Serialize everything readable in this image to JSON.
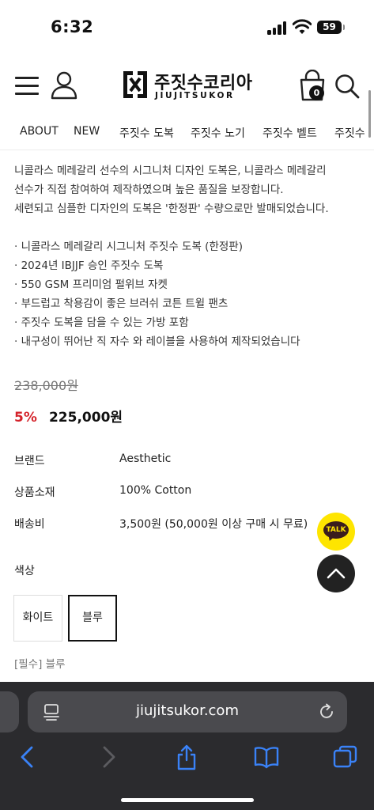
{
  "status_bar": {
    "time": "6:32",
    "battery": "59"
  },
  "header": {
    "logo_korean": "주짓수코리아",
    "logo_english": "JIUJITSUKOR",
    "cart_count": "0"
  },
  "nav": {
    "items": [
      "ABOUT",
      "NEW",
      "주짓수 도복",
      "주짓수 노기",
      "주짓수 벨트",
      "주짓수"
    ]
  },
  "description": {
    "lines": [
      "니콜라스 메레갈리 선수의 시그니처 디자인 도복은, 니콜라스 메레갈리",
      "선수가 직접 참여하여 제작하였으며 높은 품질을 보장합니다.",
      "세련되고 심플한 디자인의 도복은 '한정판' 수량으로만 발매되었습니다."
    ],
    "features": [
      "· 니콜라스 메레갈리 시그니처 주짓수 도복 (한정판)",
      "·  2024년 IBJJF 승인 주짓수 도복",
      "·  550 GSM 프리미엄 펄위브 자켓",
      "·  부드럽고 착용감이 좋은 브러쉬 코튼 트윌 팬츠",
      "·  주짓수 도복을 담을 수 있는 가방 포함",
      "·  내구성이 뛰어난 직 자수 와 레이블을 사용하여 제작되었습니다"
    ]
  },
  "price": {
    "original": "238,000원",
    "discount": "5%",
    "sale": "225,000원"
  },
  "info": {
    "brand_label": "브랜드",
    "brand_value": "Aesthetic",
    "material_label": "상품소재",
    "material_value": "100% Cotton",
    "shipping_label": "배송비",
    "shipping_value": "3,500원 (50,000원 이상 구매 시 무료)"
  },
  "color": {
    "label": "색상",
    "options": [
      "화이트",
      "블루"
    ],
    "selected": "블루",
    "required_note": "[필수] 블루"
  },
  "floating": {
    "talk_label": "TALK"
  },
  "browser": {
    "url": "jiujitsukor.com"
  }
}
